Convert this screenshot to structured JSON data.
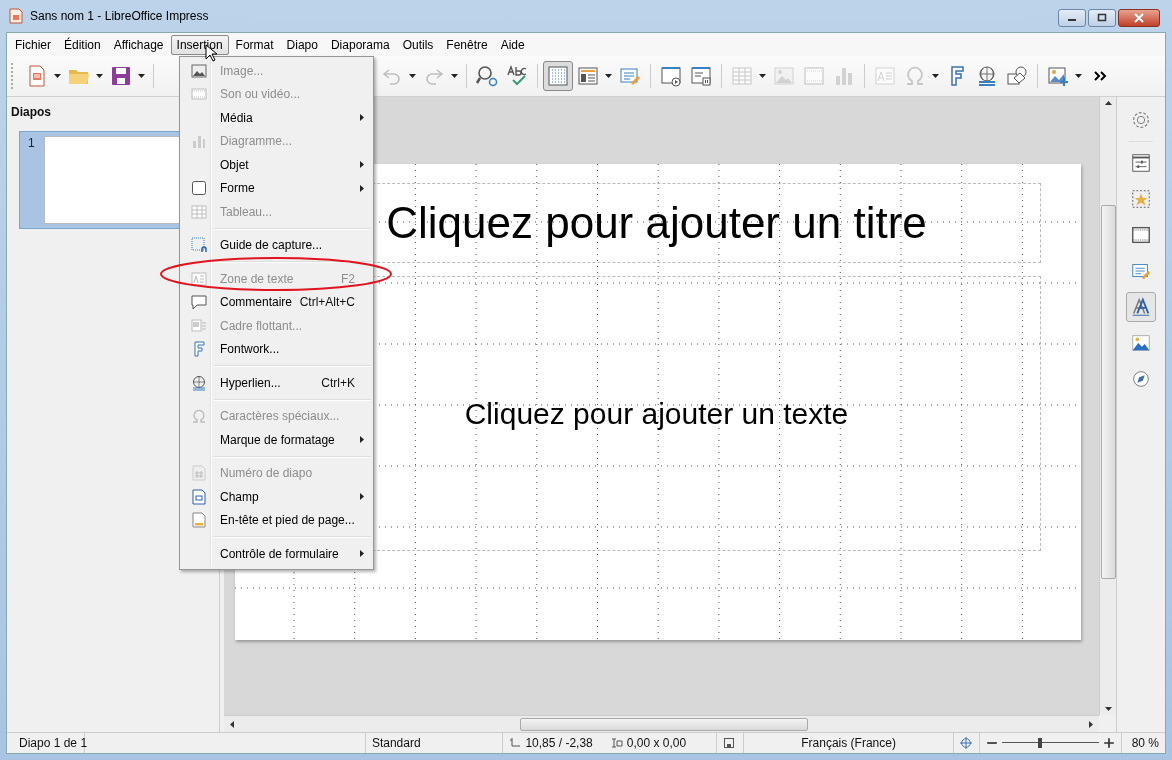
{
  "window": {
    "title": "Sans nom 1 - LibreOffice Impress"
  },
  "menu_bar": [
    {
      "label": "Fichier",
      "selected": false
    },
    {
      "label": "Édition",
      "selected": false
    },
    {
      "label": "Affichage",
      "selected": false
    },
    {
      "label": "Insertion",
      "selected": true
    },
    {
      "label": "Format",
      "selected": false
    },
    {
      "label": "Diapo",
      "selected": false
    },
    {
      "label": "Diaporama",
      "selected": false
    },
    {
      "label": "Outils",
      "selected": false
    },
    {
      "label": "Fenêtre",
      "selected": false
    },
    {
      "label": "Aide",
      "selected": false
    }
  ],
  "toolbar": {
    "left_items": [
      {
        "kind": "new",
        "disabled": false,
        "dropdown": true,
        "selected": false
      },
      {
        "kind": "open",
        "disabled": false,
        "dropdown": true,
        "selected": false
      },
      {
        "kind": "save",
        "disabled": false,
        "dropdown": true,
        "selected": false
      },
      {
        "kind": "separator"
      }
    ],
    "right_items": [
      {
        "kind": "undo",
        "disabled": true,
        "dropdown": true,
        "selected": false
      },
      {
        "kind": "redo",
        "disabled": true,
        "dropdown": true,
        "selected": false
      },
      {
        "kind": "separator"
      },
      {
        "kind": "find",
        "disabled": false,
        "dropdown": false
      },
      {
        "kind": "spelling",
        "disabled": false,
        "dropdown": false
      },
      {
        "kind": "separator"
      },
      {
        "kind": "grid",
        "disabled": false,
        "dropdown": false,
        "selected": true
      },
      {
        "kind": "layout",
        "disabled": false,
        "dropdown": true,
        "selected": false
      },
      {
        "kind": "edit",
        "disabled": false,
        "dropdown": false,
        "selected": false
      },
      {
        "kind": "separator"
      },
      {
        "kind": "start",
        "disabled": false,
        "dropdown": false,
        "selected": false
      },
      {
        "kind": "present",
        "disabled": false,
        "dropdown": false,
        "selected": false
      },
      {
        "kind": "separator"
      },
      {
        "kind": "table",
        "disabled": true,
        "dropdown": true,
        "selected": false
      },
      {
        "kind": "image",
        "disabled": true,
        "dropdown": false,
        "selected": false
      },
      {
        "kind": "video",
        "disabled": true,
        "dropdown": false,
        "selected": false
      },
      {
        "kind": "chart",
        "disabled": true,
        "dropdown": false,
        "selected": false
      },
      {
        "kind": "separator"
      },
      {
        "kind": "textbox",
        "disabled": true,
        "dropdown": false,
        "selected": false
      },
      {
        "kind": "omega",
        "disabled": true,
        "dropdown": true,
        "selected": false
      },
      {
        "kind": "fontwork",
        "disabled": false,
        "dropdown": false,
        "selected": false
      },
      {
        "kind": "hyperlink",
        "disabled": false,
        "dropdown": false,
        "selected": false
      },
      {
        "kind": "shapes",
        "disabled": false,
        "dropdown": false,
        "selected": false
      },
      {
        "kind": "separator"
      },
      {
        "kind": "insert-image",
        "disabled": false,
        "dropdown": true,
        "selected": false
      },
      {
        "kind": "more",
        "disabled": false,
        "dropdown": false,
        "selected": false
      }
    ]
  },
  "slides_pane": {
    "title": "Diapos",
    "slides": [
      {
        "number": "1",
        "selected": true
      }
    ]
  },
  "slide": {
    "title_placeholder": "Cliquez pour ajouter un titre",
    "text_placeholder": "Cliquez pour ajouter un texte"
  },
  "insert_menu": {
    "groups": [
      [
        {
          "kind": "image",
          "label": "Image...",
          "disabled": true,
          "submenu": false
        },
        {
          "kind": "video",
          "label": "Son ou vidéo...",
          "disabled": true,
          "submenu": false
        },
        {
          "kind": "plain",
          "label": "Média",
          "disabled": false,
          "submenu": true
        },
        {
          "kind": "chart",
          "label": "Diagramme...",
          "disabled": true,
          "submenu": false
        },
        {
          "kind": "plain",
          "label": "Objet",
          "disabled": false,
          "submenu": true
        },
        {
          "kind": "shape",
          "label": "Forme",
          "disabled": false,
          "submenu": true
        },
        {
          "kind": "table",
          "label": "Tableau...",
          "disabled": true,
          "submenu": false
        }
      ],
      [
        {
          "kind": "guide",
          "label": "Guide de capture...",
          "disabled": false,
          "submenu": false
        }
      ],
      [
        {
          "kind": "textbox",
          "label": "Zone de texte",
          "shortcut": "F2",
          "disabled": true,
          "submenu": false
        },
        {
          "kind": "comment",
          "label": "Commentaire",
          "shortcut": "Ctrl+Alt+C",
          "disabled": false,
          "submenu": false
        },
        {
          "kind": "frame",
          "label": "Cadre flottant...",
          "disabled": true,
          "submenu": false
        },
        {
          "kind": "fontwork",
          "label": "Fontwork...",
          "disabled": false,
          "submenu": false
        }
      ],
      [
        {
          "kind": "hyperlink",
          "label": "Hyperlien...",
          "shortcut": "Ctrl+K",
          "disabled": false,
          "submenu": false
        }
      ],
      [
        {
          "kind": "omega",
          "label": "Caractères spéciaux...",
          "disabled": true,
          "submenu": false
        },
        {
          "kind": "plain",
          "label": "Marque de formatage",
          "disabled": false,
          "submenu": true
        }
      ],
      [
        {
          "kind": "number",
          "label": "Numéro de diapo",
          "disabled": true,
          "submenu": false
        },
        {
          "kind": "field",
          "label": "Champ",
          "disabled": false,
          "submenu": true
        },
        {
          "kind": "header",
          "label": "En-tête et pied de page...",
          "disabled": false,
          "submenu": false
        }
      ],
      [
        {
          "kind": "plain",
          "label": "Contrôle de formulaire",
          "disabled": false,
          "submenu": true
        }
      ]
    ]
  },
  "deck": [
    {
      "kind": "properties",
      "selected": false
    },
    {
      "kind": "transition",
      "selected": false
    },
    {
      "kind": "animation",
      "selected": false
    },
    {
      "kind": "master",
      "selected": false
    },
    {
      "kind": "layouts",
      "selected": false
    },
    {
      "kind": "styles",
      "selected": true
    },
    {
      "kind": "gallery",
      "selected": false
    },
    {
      "kind": "navigator",
      "selected": false
    }
  ],
  "status_bar": {
    "slide_info": "Diapo 1 de 1",
    "layout": "Standard",
    "position": "10,85 / -2,38",
    "size": "0,00 x 0,00",
    "language": "Français (France)",
    "zoom": {
      "level": 0.4,
      "reading": "80 %"
    }
  }
}
